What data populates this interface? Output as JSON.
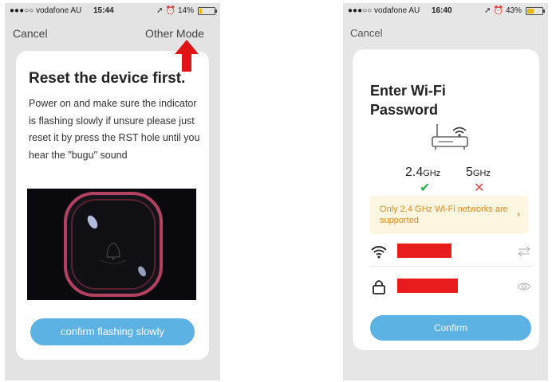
{
  "left_screen": {
    "status": {
      "carrier": "●●●○○ vodafone AU",
      "time": "15:44",
      "battery": "14%",
      "battery_level": 0.14
    },
    "nav": {
      "cancel": "Cancel",
      "other_mode": "Other Mode"
    },
    "title": "Reset the device first.",
    "instructions": "Power on and make sure the indicator is flashing slowly if unsure please just reset it by press the RST hole until you hear the \"bugu\" sound",
    "confirm_label": "confirm flashing slowly"
  },
  "right_screen": {
    "status": {
      "carrier": "●●●○○ vodafone AU",
      "time": "16:40",
      "battery": "43%",
      "battery_level": 0.43
    },
    "nav": {
      "cancel": "Cancel"
    },
    "title": "Enter Wi-Fi Password",
    "bands": {
      "band_24_value": "2.4",
      "band_24_unit": "GHz",
      "band_5_value": "5",
      "band_5_unit": "GHz"
    },
    "notice": "Only 2.4 GHz Wi-Fi networks are supported",
    "confirm_label": "Confirm"
  },
  "icons": {
    "wifi": "wifi-icon",
    "lock": "lock-icon",
    "eye": "eye-icon",
    "swap": "swap-icon",
    "router": "router-icon",
    "arrow": "red-arrow-icon",
    "check": "check-icon",
    "cross": "cross-icon"
  },
  "colors": {
    "accent": "#5db2e4",
    "redaction": "#e81c1c",
    "ok": "#2fb34a",
    "fail": "#e04848",
    "notice_bg": "#fdf6e0",
    "notice_text": "#e08a1a"
  }
}
